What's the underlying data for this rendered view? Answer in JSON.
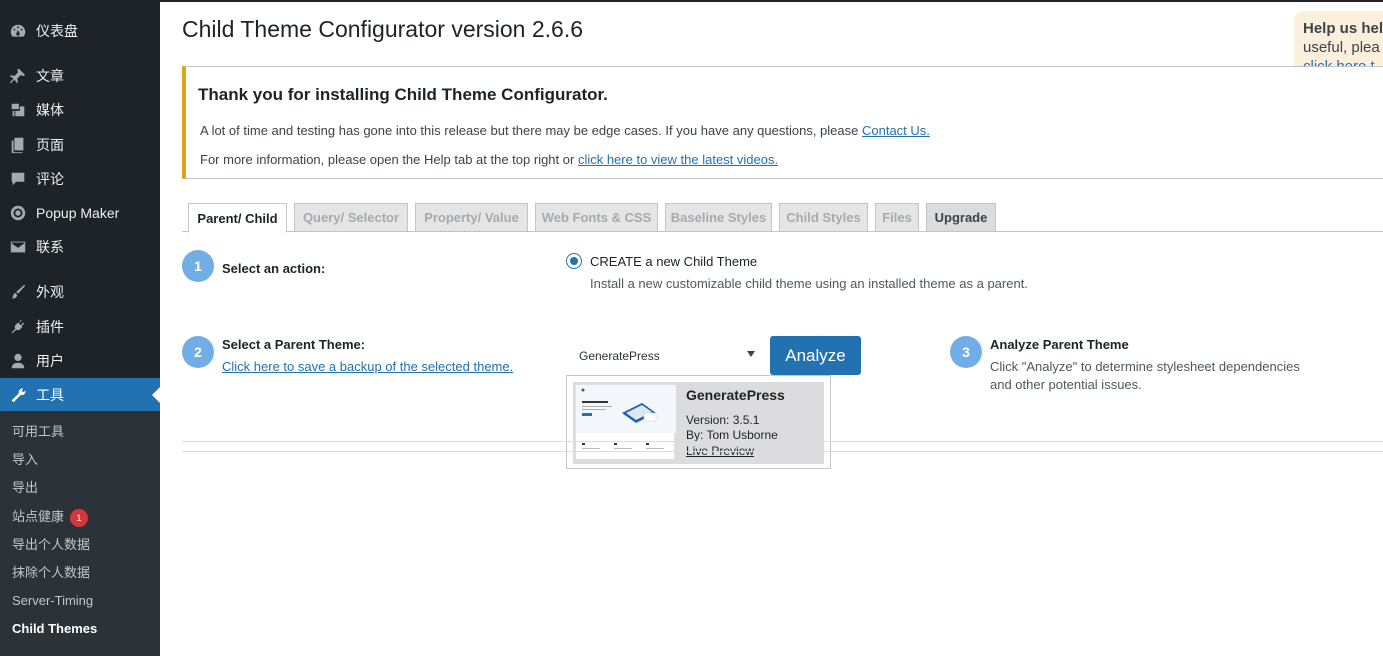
{
  "sidebar": {
    "items": [
      {
        "label": "仪表盘",
        "icon": "dashboard-icon"
      },
      {
        "label": "文章",
        "icon": "pin-icon"
      },
      {
        "label": "媒体",
        "icon": "media-icon"
      },
      {
        "label": "页面",
        "icon": "page-icon"
      },
      {
        "label": "评论",
        "icon": "comment-icon"
      },
      {
        "label": "Popup Maker",
        "icon": "popup-maker-icon"
      },
      {
        "label": "联系",
        "icon": "mail-icon"
      },
      {
        "label": "外观",
        "icon": "brush-icon"
      },
      {
        "label": "插件",
        "icon": "plugin-icon"
      },
      {
        "label": "用户",
        "icon": "user-icon"
      },
      {
        "label": "工具",
        "icon": "wrench-icon"
      }
    ],
    "submenu": [
      {
        "label": "可用工具"
      },
      {
        "label": "导入"
      },
      {
        "label": "导出"
      },
      {
        "label": "站点健康",
        "badge": "1"
      },
      {
        "label": "导出个人数据"
      },
      {
        "label": "抹除个人数据"
      },
      {
        "label": "Server-Timing"
      },
      {
        "label": "Child Themes"
      }
    ]
  },
  "page": {
    "title": "Child Theme Configurator version 2.6.6"
  },
  "help_box": {
    "title": "Help us hel",
    "line": "useful, plea",
    "link": "click here t"
  },
  "notice": {
    "title": "Thank you for installing Child Theme Configurator.",
    "p1_text": "A lot of time and testing has gone into this release but there may be edge cases. If you have any questions, please ",
    "p1_link": "Contact Us.",
    "p2_text": "For more information, please open the Help tab at the top right or ",
    "p2_link": "click here to view the latest videos."
  },
  "tabs": [
    {
      "label": "Parent/ Child"
    },
    {
      "label": "Query/ Selector"
    },
    {
      "label": "Property/ Value"
    },
    {
      "label": "Web Fonts & CSS"
    },
    {
      "label": "Baseline Styles"
    },
    {
      "label": "Child Styles"
    },
    {
      "label": "Files"
    },
    {
      "label": "Upgrade"
    }
  ],
  "step1": {
    "num": "1",
    "label": "Select an action:",
    "option_label": "CREATE a new Child Theme",
    "option_desc": "Install a new customizable child theme using an installed theme as a parent."
  },
  "step2": {
    "num": "2",
    "label": "Select a Parent Theme:",
    "backup_link": "Click here to save a backup of the selected theme.",
    "selected_theme": "GeneratePress",
    "analyze_label": "Analyze"
  },
  "step3": {
    "num": "3",
    "label": "Analyze Parent Theme",
    "desc1": "Click \"Analyze\" to determine stylesheet dependencies",
    "desc2": "and other potential issues."
  },
  "theme_card": {
    "name": "GeneratePress",
    "version": "Version: 3.5.1",
    "author": "By: Tom Usborne",
    "preview_link": "Live Preview"
  },
  "colors": {
    "sidebar_bg": "#1d2327",
    "accent": "#2271b1",
    "notice_border": "#dba617",
    "step_circle": "#72aee6"
  }
}
